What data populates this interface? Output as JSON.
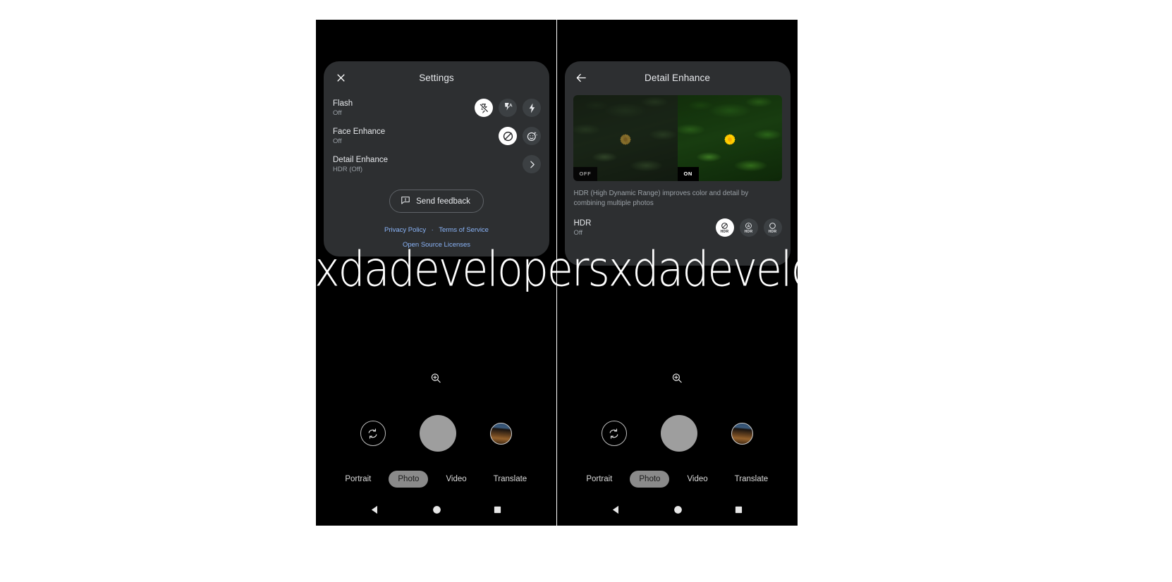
{
  "left_phone": {
    "sheet": {
      "close_icon": "close-icon",
      "title": "Settings",
      "rows": [
        {
          "title": "Flash",
          "subtitle": "Off",
          "options": [
            {
              "name": "flash-off-icon",
              "selected": true
            },
            {
              "name": "flash-auto-icon",
              "selected": false
            },
            {
              "name": "flash-on-icon",
              "selected": false
            }
          ]
        },
        {
          "title": "Face Enhance",
          "subtitle": "Off",
          "options": [
            {
              "name": "face-enhance-off-icon",
              "selected": true
            },
            {
              "name": "face-enhance-on-icon",
              "selected": false
            }
          ]
        },
        {
          "title": "Detail Enhance",
          "subtitle": "HDR (Off)",
          "options": [
            {
              "name": "chevron-right-icon",
              "selected": false
            }
          ]
        }
      ],
      "feedback_label": "Send feedback",
      "feedback_icon": "feedback-icon",
      "links": {
        "privacy": "Privacy Policy",
        "separator": "·",
        "terms": "Terms of Service",
        "licenses": "Open Source Licenses"
      }
    },
    "camera": {
      "zoom_icon": "zoom-icon",
      "flip_icon": "camera-flip-icon",
      "shutter_label": "shutter-button",
      "thumbnail_label": "gallery-thumbnail",
      "modes": [
        {
          "label": "Portrait",
          "active": false
        },
        {
          "label": "Photo",
          "active": true
        },
        {
          "label": "Video",
          "active": false
        },
        {
          "label": "Translate",
          "active": false
        }
      ],
      "navbar": {
        "back": "back-triangle-icon",
        "home": "home-circle-icon",
        "recents": "recents-square-icon"
      }
    }
  },
  "right_phone": {
    "sheet": {
      "back_icon": "back-arrow-icon",
      "title": "Detail Enhance",
      "preview": {
        "off_label": "OFF",
        "on_label": "ON",
        "alt": "flower-comparison-image"
      },
      "description": "HDR (High Dynamic Range) improves color and detail by combining multiple photos",
      "row": {
        "title": "HDR",
        "subtitle": "Off",
        "options": [
          {
            "name": "hdr-off-icon",
            "caption": "HDR",
            "selected": true
          },
          {
            "name": "hdr-auto-icon",
            "caption": "HDR",
            "glyph": "A",
            "selected": false
          },
          {
            "name": "hdr-on-icon",
            "caption": "HDR",
            "selected": false
          }
        ]
      }
    },
    "camera": {
      "zoom_icon": "zoom-icon",
      "flip_icon": "camera-flip-icon",
      "shutter_label": "shutter-button",
      "thumbnail_label": "gallery-thumbnail",
      "modes": [
        {
          "label": "Portrait",
          "active": false
        },
        {
          "label": "Photo",
          "active": true
        },
        {
          "label": "Video",
          "active": false
        },
        {
          "label": "Translate",
          "active": false
        }
      ],
      "navbar": {
        "back": "back-triangle-icon",
        "home": "home-circle-icon",
        "recents": "recents-square-icon"
      }
    }
  },
  "watermark": {
    "text": "xdadevelopersxdadevelopers"
  },
  "colors": {
    "sheet_bg": "#2d2f31",
    "link": "#8ab4f8",
    "selected_bg": "#ffffff",
    "option_bg": "#3c4043",
    "text_primary": "#e8eaed",
    "text_secondary": "#9aa0a6"
  }
}
